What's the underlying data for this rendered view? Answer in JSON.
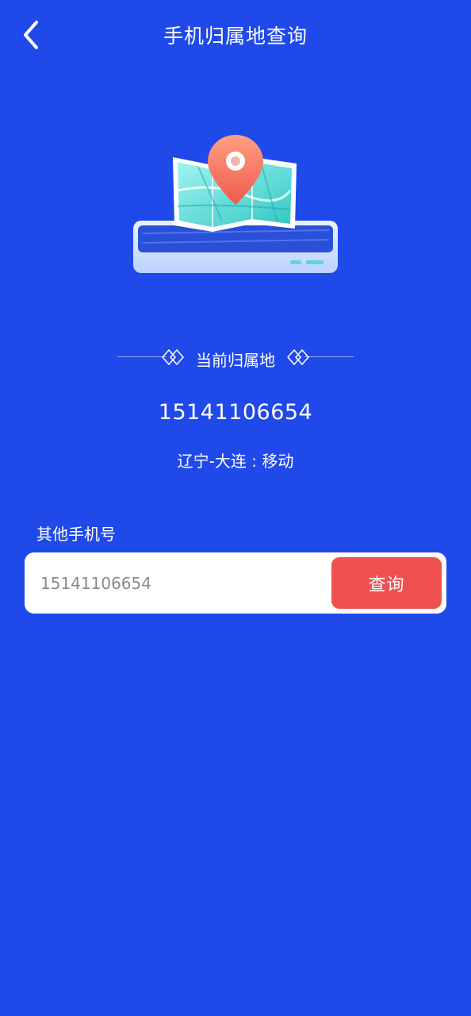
{
  "header": {
    "title": "手机归属地查询",
    "back_icon": "chevron-left-icon"
  },
  "illustration": {
    "icon": "map-location-pin-icon"
  },
  "current": {
    "section_label": "当前归属地",
    "phone_number": "15141106654",
    "location": "辽宁-大连 : 移动"
  },
  "query": {
    "label": "其他手机号",
    "input_placeholder": "15141106654",
    "input_value": "",
    "button_label": "查询"
  },
  "colors": {
    "background": "#2049ea",
    "button": "#f15050",
    "card": "#ffffff"
  }
}
